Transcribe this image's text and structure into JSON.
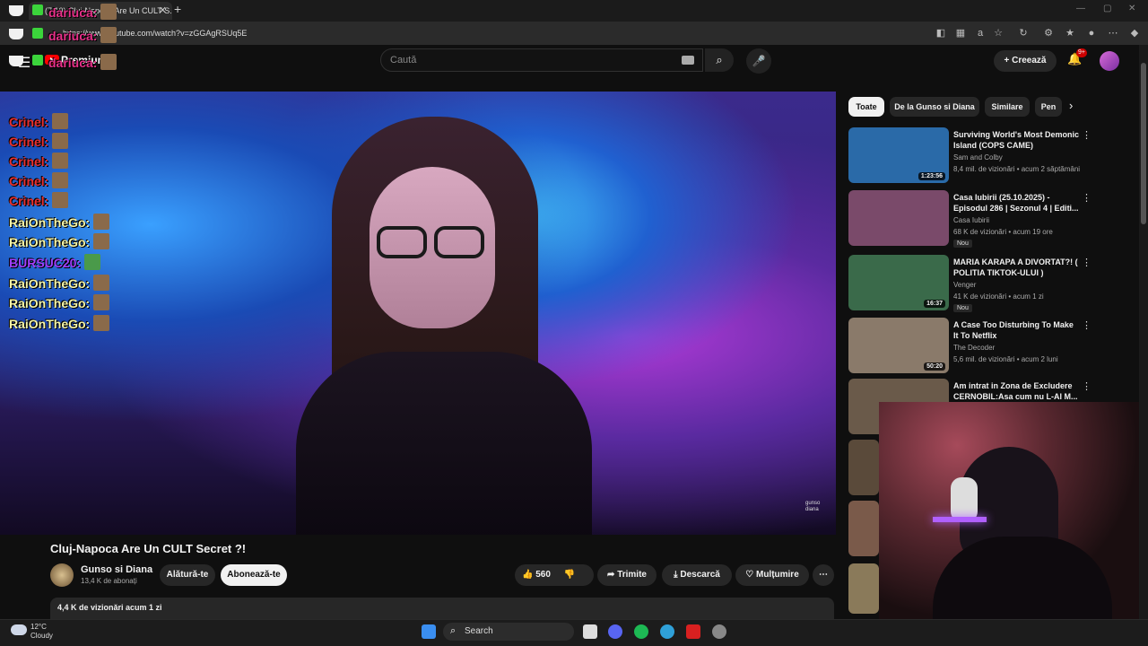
{
  "browser": {
    "tab_title": "(7 10) Cluj-Napoca Are Un CULT S...",
    "url": "https://www.youtube.com/watch?v=zGGAgRSUq5E"
  },
  "youtube": {
    "premium_label": "Premium",
    "search_placeholder": "Caută",
    "create_label": "Creează",
    "notif_badge": "9+"
  },
  "chat": [
    {
      "user": "dariuca:",
      "color": "#e8308a"
    },
    {
      "user": "dariuca:",
      "color": "#e8308a"
    },
    {
      "user": "dariuca:",
      "color": "#e8308a"
    },
    {
      "user": "Crinel:",
      "color": "#e83030"
    },
    {
      "user": "Crinel:",
      "color": "#e83030"
    },
    {
      "user": "Crinel:",
      "color": "#e83030"
    },
    {
      "user": "Crinel:",
      "color": "#e83030"
    },
    {
      "user": "Crinel:",
      "color": "#e83030"
    },
    {
      "user": "RaiOnTheGo:",
      "color": "#f5f5a8"
    },
    {
      "user": "RaiOnTheGo:",
      "color": "#f5f5a8"
    },
    {
      "user": "BURSUC20:",
      "color": "#a040ff"
    },
    {
      "user": "RaiOnTheGo:",
      "color": "#f5f5a8"
    },
    {
      "user": "RaiOnTheGo:",
      "color": "#f5f5a8"
    },
    {
      "user": "RaiOnTheGo:",
      "color": "#f5f5a8"
    }
  ],
  "video": {
    "watermark_line1": "gunso",
    "watermark_line2": "diana",
    "title": "Cluj-Napoca Are Un CULT Secret ?!",
    "channel": "Gunso si Diana",
    "subscribers": "13,4 K de abonați",
    "join_label": "Alătură-te",
    "subscribe_label": "Abonează-te",
    "likes": "560",
    "share_label": "Trimite",
    "download_label": "Descarcă",
    "thanks_label": "Mulțumire",
    "views_date": "4,4 K de vizionări  acum 1 zi"
  },
  "chips": [
    "Toate",
    "De la Gunso si Diana",
    "Similare",
    "Pen"
  ],
  "recommendations": [
    {
      "title": "Surviving World's Most Demonic Island (COPS CAME)",
      "channel": "Sam and Colby",
      "meta": "8,4 mil. de vizionări • acum 2 săptămâni",
      "duration": "1:23:56",
      "badge": "",
      "thumb": "#2a6aa8"
    },
    {
      "title": "Casa Iubirii (25.10.2025) - Episodul 286 | Sezonul 4 | Editi...",
      "channel": "Casa Iubirii",
      "meta": "68 K de vizionări • acum 19 ore",
      "duration": "",
      "badge": "Nou",
      "thumb": "#7a4a6a"
    },
    {
      "title": "MARIA KARAPA A DIVORTAT?! ( POLITIA TIKTOK-ULUI )",
      "channel": "Venger",
      "meta": "41 K de vizionări • acum 1 zi",
      "duration": "16:37",
      "badge": "Nou",
      "thumb": "#3a6a4a"
    },
    {
      "title": "A Case Too Disturbing To Make It To Netflix",
      "channel": "The Decoder",
      "meta": "5,6 mil. de vizionări • acum 2 luni",
      "duration": "50:20",
      "badge": "",
      "thumb": "#8a7a6a"
    },
    {
      "title": "Am intrat in Zona de Excludere CERNOBIL:Asa cum nu L-AI M...",
      "channel": "",
      "meta": "",
      "duration": "",
      "badge": "",
      "thumb": "#6a5a4a"
    }
  ],
  "taskbar": {
    "temperature": "12°C",
    "condition": "Cloudy",
    "search_label": "Search"
  }
}
